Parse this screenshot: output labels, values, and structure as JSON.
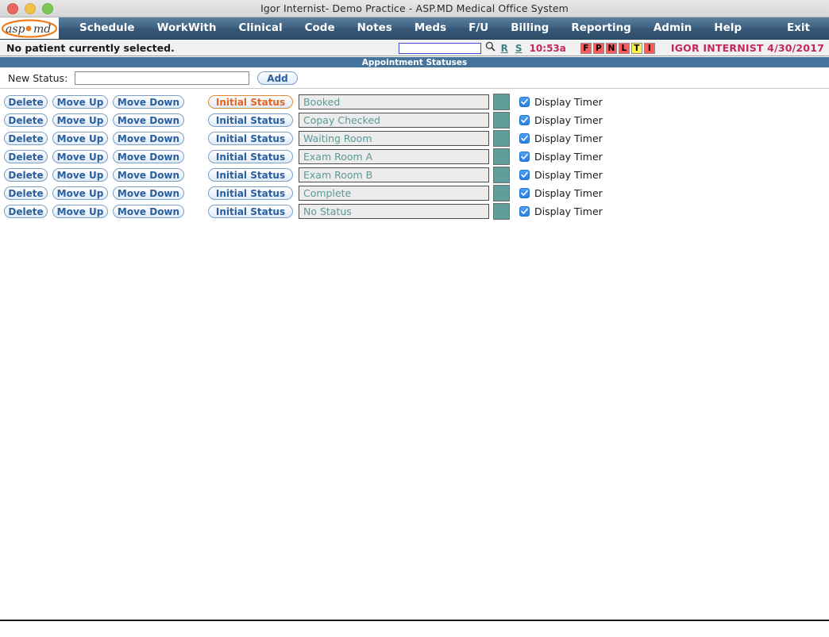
{
  "window": {
    "title": "Igor Internist- Demo Practice - ASP.MD Medical Office System",
    "controls": {
      "close": "close",
      "minimize": "minimize",
      "maximize": "maximize"
    }
  },
  "brand": {
    "logo_text": "asp",
    "logo_text2": "md",
    "accent_color": "#f07d1e"
  },
  "nav": {
    "items": [
      {
        "label": "Schedule"
      },
      {
        "label": "WorkWith"
      },
      {
        "label": "Clinical"
      },
      {
        "label": "Code"
      },
      {
        "label": "Notes"
      },
      {
        "label": "Meds"
      },
      {
        "label": "F/U"
      },
      {
        "label": "Billing"
      },
      {
        "label": "Reporting"
      },
      {
        "label": "Admin"
      },
      {
        "label": "Help"
      }
    ],
    "exit_label": "Exit"
  },
  "patient_bar": {
    "no_patient_text": "No patient currently selected.",
    "search_value": "",
    "search_placeholder": "",
    "search_icon": "search-icon",
    "links": [
      {
        "label": "R"
      },
      {
        "label": "S"
      }
    ],
    "time": "10:53a",
    "badges": [
      {
        "label": "F",
        "color": "#ff5a5a"
      },
      {
        "label": "P",
        "color": "#ff5a5a"
      },
      {
        "label": "N",
        "color": "#ff5a5a"
      },
      {
        "label": "L",
        "color": "#ff5a5a"
      },
      {
        "label": "T",
        "color": "#fdf24b"
      },
      {
        "label": "I",
        "color": "#ff5a5a"
      }
    ],
    "user_info": "IGOR INTERNIST 4/30/2017"
  },
  "section": {
    "title": "Appointment Statuses"
  },
  "new_status": {
    "label": "New Status:",
    "value": "",
    "placeholder": "",
    "add_label": "Add"
  },
  "row_actions": {
    "delete_label": "Delete",
    "move_up_label": "Move Up",
    "move_down_label": "Move Down",
    "initial_status_label": "Initial Status",
    "display_timer_label": "Display Timer"
  },
  "statuses": [
    {
      "name": "Booked",
      "color": "#5f9e9a",
      "display_timer": true,
      "is_initial": true
    },
    {
      "name": "Copay Checked",
      "color": "#5f9e9a",
      "display_timer": true,
      "is_initial": false
    },
    {
      "name": "Waiting Room",
      "color": "#5f9e9a",
      "display_timer": true,
      "is_initial": false
    },
    {
      "name": "Exam Room A",
      "color": "#5f9e9a",
      "display_timer": true,
      "is_initial": false
    },
    {
      "name": "Exam Room B",
      "color": "#5f9e9a",
      "display_timer": true,
      "is_initial": false
    },
    {
      "name": "Complete",
      "color": "#5f9e9a",
      "display_timer": true,
      "is_initial": false
    },
    {
      "name": "No Status",
      "color": "#5f9e9a",
      "display_timer": true,
      "is_initial": false
    }
  ]
}
